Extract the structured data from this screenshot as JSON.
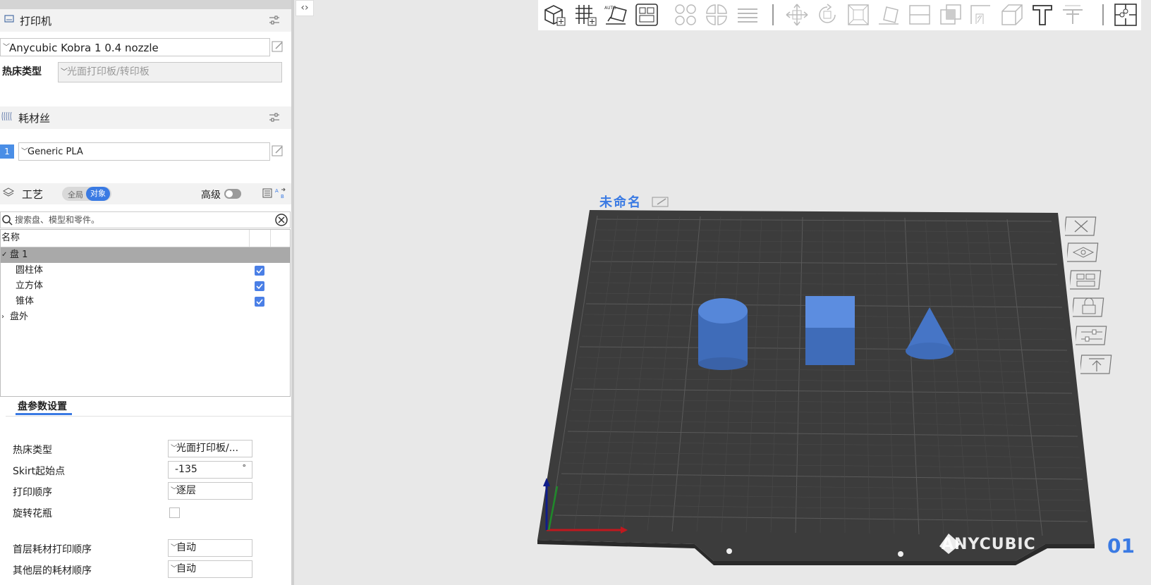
{
  "printer": {
    "section_title": "打印机",
    "preset": "Anycubic Kobra 1 0.4 nozzle",
    "bed_label": "热床类型",
    "bed_value": "光面打印板/转印板"
  },
  "filament": {
    "section_title": "耗材丝",
    "slot": "1",
    "preset": "Generic PLA"
  },
  "process": {
    "section_title": "工艺",
    "toggle_global": "全局",
    "toggle_object": "对象",
    "advanced_label": "高级",
    "search_placeholder": "搜索盘、模型和零件。"
  },
  "tree": {
    "header_name": "名称",
    "plate": "盘 1",
    "objects": [
      "圆柱体",
      "立方体",
      "锥体"
    ],
    "outside": "盘外"
  },
  "plate_settings": {
    "tab": "盘参数设置",
    "rows": [
      {
        "label": "热床类型",
        "value": "光面打印板/..."
      },
      {
        "label": "Skirt起始点",
        "value": "-135",
        "unit": "°"
      },
      {
        "label": "打印顺序",
        "value": "逐层"
      },
      {
        "label": "旋转花瓶",
        "value": ""
      },
      {
        "label": "首层耗材打印顺序",
        "value": "自动"
      },
      {
        "label": "其他层的耗材顺序",
        "value": "自动"
      }
    ]
  },
  "viewport": {
    "plate_name": "未命名",
    "brand": "ANYCUBIC",
    "plate_number": "01"
  },
  "colors": {
    "accent": "#3a7ae3",
    "plate": "#3c3c3c",
    "model": "#4d7fd6"
  },
  "icons": {
    "toolbar": [
      "add-cube-icon",
      "grid-plate-icon",
      "auto-orient-icon",
      "arrange-icon",
      "split-objects-icon",
      "split-parts-icon",
      "layers-icon",
      "move-icon",
      "rotate-icon",
      "scale-icon",
      "lay-on-face-icon",
      "cut-icon",
      "boolean-icon",
      "support-paint-icon",
      "measure-icon",
      "text-icon",
      "emboss-icon",
      "assembly-icon"
    ]
  }
}
